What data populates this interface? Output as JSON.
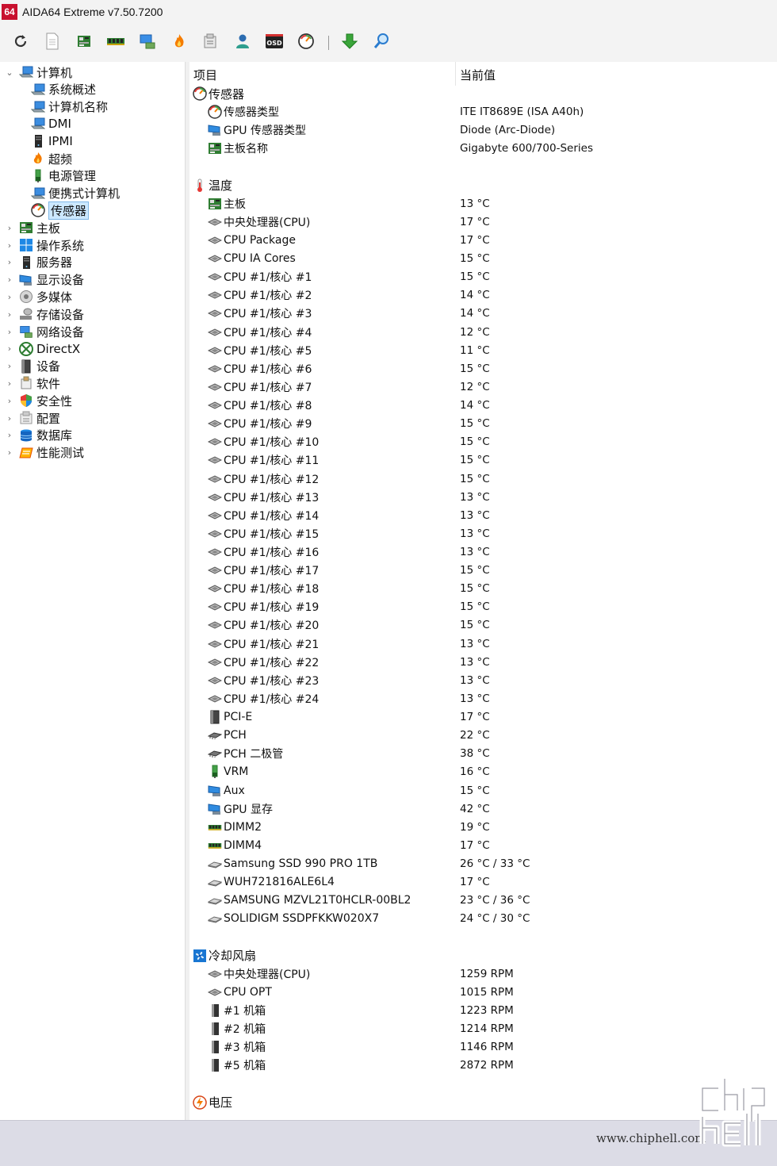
{
  "window": {
    "logo_text": "64",
    "title": "AIDA64 Extreme v7.50.7200"
  },
  "toolbar": {
    "buttons": [
      "refresh-icon",
      "report-icon",
      "motherboard-icon",
      "memory-icon",
      "network-icon",
      "overclock-icon",
      "tools-icon",
      "user-icon",
      "osd-icon",
      "gauge-icon",
      "download-icon",
      "search-icon"
    ],
    "osd_label": "OSD"
  },
  "tree": {
    "items": [
      {
        "label": "计算机",
        "level": 0,
        "expanded": true,
        "icon": "computer-icon",
        "selected": false
      },
      {
        "label": "系统概述",
        "level": 1,
        "icon": "computer-icon",
        "selected": false
      },
      {
        "label": "计算机名称",
        "level": 1,
        "icon": "computer-icon",
        "selected": false
      },
      {
        "label": "DMI",
        "level": 1,
        "icon": "computer-icon",
        "selected": false
      },
      {
        "label": "IPMI",
        "level": 1,
        "icon": "server-icon",
        "selected": false
      },
      {
        "label": "超频",
        "level": 1,
        "icon": "flame-icon",
        "selected": false
      },
      {
        "label": "电源管理",
        "level": 1,
        "icon": "power-icon",
        "selected": false
      },
      {
        "label": "便携式计算机",
        "level": 1,
        "icon": "computer-icon",
        "selected": false
      },
      {
        "label": "传感器",
        "level": 1,
        "icon": "sensor-icon",
        "selected": true
      },
      {
        "label": "主板",
        "level": 0,
        "expanded": false,
        "icon": "motherboard-icon",
        "selected": false
      },
      {
        "label": "操作系统",
        "level": 0,
        "expanded": false,
        "icon": "windows-icon",
        "selected": false
      },
      {
        "label": "服务器",
        "level": 0,
        "expanded": false,
        "icon": "server-icon",
        "selected": false
      },
      {
        "label": "显示设备",
        "level": 0,
        "expanded": false,
        "icon": "display-icon",
        "selected": false
      },
      {
        "label": "多媒体",
        "level": 0,
        "expanded": false,
        "icon": "speaker-icon",
        "selected": false
      },
      {
        "label": "存储设备",
        "level": 0,
        "expanded": false,
        "icon": "storage-icon",
        "selected": false
      },
      {
        "label": "网络设备",
        "level": 0,
        "expanded": false,
        "icon": "network-icon",
        "selected": false
      },
      {
        "label": "DirectX",
        "level": 0,
        "expanded": false,
        "icon": "xbox-icon",
        "selected": false
      },
      {
        "label": "设备",
        "level": 0,
        "expanded": false,
        "icon": "device-icon",
        "selected": false
      },
      {
        "label": "软件",
        "level": 0,
        "expanded": false,
        "icon": "software-icon",
        "selected": false
      },
      {
        "label": "安全性",
        "level": 0,
        "expanded": false,
        "icon": "shield-icon",
        "selected": false
      },
      {
        "label": "配置",
        "level": 0,
        "expanded": false,
        "icon": "config-icon",
        "selected": false
      },
      {
        "label": "数据库",
        "level": 0,
        "expanded": false,
        "icon": "database-icon",
        "selected": false
      },
      {
        "label": "性能测试",
        "level": 0,
        "expanded": false,
        "icon": "benchmark-icon",
        "selected": false
      }
    ]
  },
  "details": {
    "col_item": "项目",
    "col_value": "当前值",
    "rows": [
      {
        "type": "group",
        "name": "传感器",
        "icon": "sensor-icon"
      },
      {
        "type": "item",
        "name": "传感器类型",
        "value": "ITE IT8689E  (ISA A40h)",
        "icon": "sensor-icon"
      },
      {
        "type": "item",
        "name": "GPU 传感器类型",
        "value": "Diode  (Arc-Diode)",
        "icon": "display-icon"
      },
      {
        "type": "item",
        "name": "主板名称",
        "value": "Gigabyte 600/700-Series",
        "icon": "motherboard-icon"
      },
      {
        "type": "blank"
      },
      {
        "type": "group",
        "name": "温度",
        "icon": "thermometer-icon"
      },
      {
        "type": "item",
        "name": "主板",
        "value": "13 °C",
        "icon": "motherboard-icon"
      },
      {
        "type": "item",
        "name": "中央处理器(CPU)",
        "value": "17 °C",
        "icon": "cpu-icon"
      },
      {
        "type": "item",
        "name": "CPU Package",
        "value": "17 °C",
        "icon": "cpu-icon"
      },
      {
        "type": "item",
        "name": "CPU IA Cores",
        "value": "15 °C",
        "icon": "cpu-icon"
      },
      {
        "type": "item",
        "name": "CPU #1/核心 #1",
        "value": "15 °C",
        "icon": "cpu-icon"
      },
      {
        "type": "item",
        "name": "CPU #1/核心 #2",
        "value": "14 °C",
        "icon": "cpu-icon"
      },
      {
        "type": "item",
        "name": "CPU #1/核心 #3",
        "value": "14 °C",
        "icon": "cpu-icon"
      },
      {
        "type": "item",
        "name": "CPU #1/核心 #4",
        "value": "12 °C",
        "icon": "cpu-icon"
      },
      {
        "type": "item",
        "name": "CPU #1/核心 #5",
        "value": "11 °C",
        "icon": "cpu-icon"
      },
      {
        "type": "item",
        "name": "CPU #1/核心 #6",
        "value": "15 °C",
        "icon": "cpu-icon"
      },
      {
        "type": "item",
        "name": "CPU #1/核心 #7",
        "value": "12 °C",
        "icon": "cpu-icon"
      },
      {
        "type": "item",
        "name": "CPU #1/核心 #8",
        "value": "14 °C",
        "icon": "cpu-icon"
      },
      {
        "type": "item",
        "name": "CPU #1/核心 #9",
        "value": "15 °C",
        "icon": "cpu-icon"
      },
      {
        "type": "item",
        "name": "CPU #1/核心 #10",
        "value": "15 °C",
        "icon": "cpu-icon"
      },
      {
        "type": "item",
        "name": "CPU #1/核心 #11",
        "value": "15 °C",
        "icon": "cpu-icon"
      },
      {
        "type": "item",
        "name": "CPU #1/核心 #12",
        "value": "15 °C",
        "icon": "cpu-icon"
      },
      {
        "type": "item",
        "name": "CPU #1/核心 #13",
        "value": "13 °C",
        "icon": "cpu-icon"
      },
      {
        "type": "item",
        "name": "CPU #1/核心 #14",
        "value": "13 °C",
        "icon": "cpu-icon"
      },
      {
        "type": "item",
        "name": "CPU #1/核心 #15",
        "value": "13 °C",
        "icon": "cpu-icon"
      },
      {
        "type": "item",
        "name": "CPU #1/核心 #16",
        "value": "13 °C",
        "icon": "cpu-icon"
      },
      {
        "type": "item",
        "name": "CPU #1/核心 #17",
        "value": "15 °C",
        "icon": "cpu-icon"
      },
      {
        "type": "item",
        "name": "CPU #1/核心 #18",
        "value": "15 °C",
        "icon": "cpu-icon"
      },
      {
        "type": "item",
        "name": "CPU #1/核心 #19",
        "value": "15 °C",
        "icon": "cpu-icon"
      },
      {
        "type": "item",
        "name": "CPU #1/核心 #20",
        "value": "15 °C",
        "icon": "cpu-icon"
      },
      {
        "type": "item",
        "name": "CPU #1/核心 #21",
        "value": "13 °C",
        "icon": "cpu-icon"
      },
      {
        "type": "item",
        "name": "CPU #1/核心 #22",
        "value": "13 °C",
        "icon": "cpu-icon"
      },
      {
        "type": "item",
        "name": "CPU #1/核心 #23",
        "value": "13 °C",
        "icon": "cpu-icon"
      },
      {
        "type": "item",
        "name": "CPU #1/核心 #24",
        "value": "13 °C",
        "icon": "cpu-icon"
      },
      {
        "type": "item",
        "name": "PCI-E",
        "value": "17 °C",
        "icon": "device-icon"
      },
      {
        "type": "item",
        "name": "PCH",
        "value": "22 °C",
        "icon": "chip-icon"
      },
      {
        "type": "item",
        "name": "PCH 二极管",
        "value": "38 °C",
        "icon": "chip-icon"
      },
      {
        "type": "item",
        "name": "VRM",
        "value": "16 °C",
        "icon": "power-icon"
      },
      {
        "type": "item",
        "name": "Aux",
        "value": "15 °C",
        "icon": "display-icon"
      },
      {
        "type": "item",
        "name": "GPU 显存",
        "value": "42 °C",
        "icon": "display-icon"
      },
      {
        "type": "item",
        "name": "DIMM2",
        "value": "19 °C",
        "icon": "memory-icon"
      },
      {
        "type": "item",
        "name": "DIMM4",
        "value": "17 °C",
        "icon": "memory-icon"
      },
      {
        "type": "item",
        "name": "Samsung SSD 990 PRO 1TB",
        "value": "26 °C / 33 °C",
        "icon": "drive-icon"
      },
      {
        "type": "item",
        "name": "WUH721816ALE6L4",
        "value": "17 °C",
        "icon": "drive-icon"
      },
      {
        "type": "item",
        "name": "SAMSUNG MZVL21T0HCLR-00BL2",
        "value": "23 °C / 36 °C",
        "icon": "drive-icon"
      },
      {
        "type": "item",
        "name": "SOLIDIGM SSDPFKKW020X7",
        "value": "24 °C / 30 °C",
        "icon": "drive-icon"
      },
      {
        "type": "blank"
      },
      {
        "type": "group",
        "name": "冷却风扇",
        "icon": "fan-icon"
      },
      {
        "type": "item",
        "name": "中央处理器(CPU)",
        "value": "1259 RPM",
        "icon": "cpu-icon"
      },
      {
        "type": "item",
        "name": "CPU OPT",
        "value": "1015 RPM",
        "icon": "cpu-icon"
      },
      {
        "type": "item",
        "name": "#1 机箱",
        "value": "1223 RPM",
        "icon": "case-icon"
      },
      {
        "type": "item",
        "name": "#2 机箱",
        "value": "1214 RPM",
        "icon": "case-icon"
      },
      {
        "type": "item",
        "name": "#3 机箱",
        "value": "1146 RPM",
        "icon": "case-icon"
      },
      {
        "type": "item",
        "name": "#5 机箱",
        "value": "2872 RPM",
        "icon": "case-icon"
      },
      {
        "type": "blank"
      },
      {
        "type": "group",
        "name": "电压",
        "icon": "voltage-icon"
      }
    ]
  },
  "watermark": {
    "url": "www.chiphell.com",
    "logo": "chiphell-logo"
  }
}
